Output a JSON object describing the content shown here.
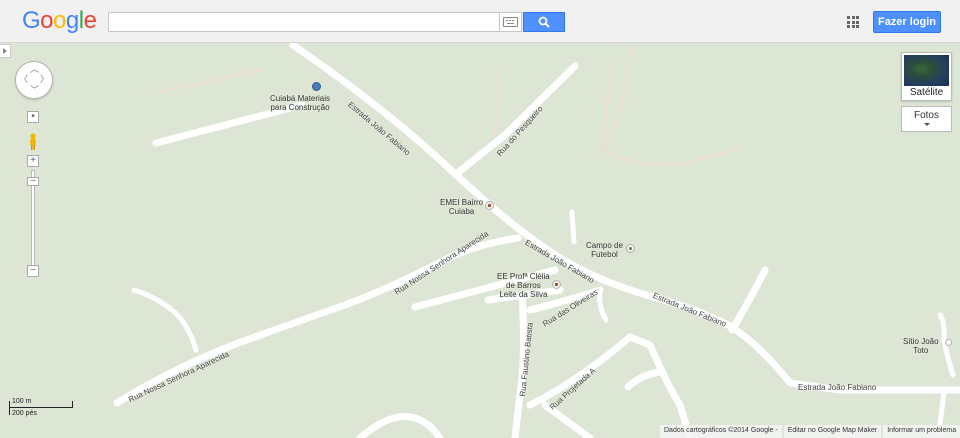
{
  "header": {
    "logo_text": "Google",
    "search_placeholder": "",
    "login_label": "Fazer login",
    "icons": [
      "keyboard-icon",
      "search-icon",
      "apps-grid-icon"
    ]
  },
  "map_controls": {
    "satellite_label": "Satélite",
    "photos_label": "Fotos",
    "scale_metric": "100 m",
    "scale_imperial": "200 pés"
  },
  "places": [
    {
      "name": "Cuiabá Materiais\npara Construção",
      "kind": "shop"
    },
    {
      "name": "EMEI Bairro\nCuiaba",
      "kind": "school"
    },
    {
      "name": "Campo de\nFutebol",
      "kind": "sport"
    },
    {
      "name": "EE Profª Clélia\nde Barros\nLeite da Silva",
      "kind": "school"
    },
    {
      "name": "Sítio João\nToto",
      "kind": "place"
    }
  ],
  "roads": [
    "Estrada João Fabiano",
    "Rua do Pesqueiro",
    "Estrada João Fabiano",
    "Rua Nossa Senhora Aparecida",
    "Estrada João Fabiano",
    "Rua das Oliveiras",
    "Rua Faustino Batista",
    "Rua Nossa Senhora Aparecida",
    "Rua Projetada A",
    "Estrada João Fabiano"
  ],
  "footer": {
    "attribution": "Dados cartográficos ©2014 Google -",
    "map_maker": "Editar no Google Map Maker",
    "report": "Informar um problema"
  },
  "colors": {
    "map_background": "#dde6d4",
    "road": "#ffffff",
    "accent_blue": "#4d90fe"
  }
}
